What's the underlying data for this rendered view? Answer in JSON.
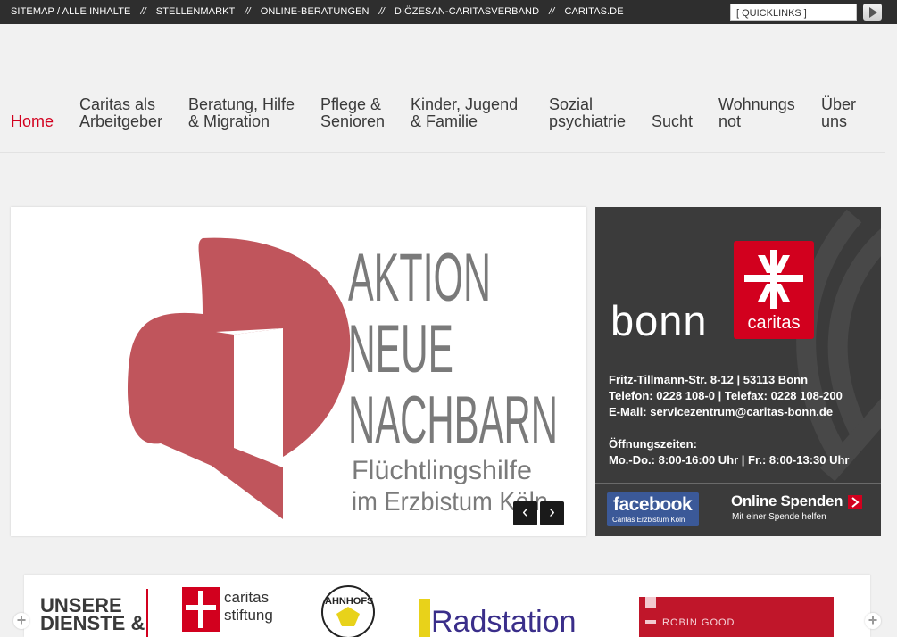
{
  "topbar": {
    "links": [
      "SITEMAP / ALLE INHALTE",
      "STELLENMARKT",
      "ONLINE-BERATUNGEN",
      "DIÖZESAN-CARITASVERBAND",
      "CARITAS.DE"
    ],
    "separator": "//",
    "quicklinks_value": "[ QUICKLINKS ]"
  },
  "nav": {
    "items": [
      {
        "label": "Home",
        "active": true
      },
      {
        "label": "Caritas als\nArbeitgeber"
      },
      {
        "label": "Beratung, Hilfe\n& Migration"
      },
      {
        "label": "Pflege &\nSenioren"
      },
      {
        "label": "Kinder, Jugend\n& Familie"
      },
      {
        "label": "Sozial\npsychiatrie"
      },
      {
        "label": "Sucht"
      },
      {
        "label": "Wohnungs\nnot"
      },
      {
        "label": "Über\nuns"
      }
    ]
  },
  "slider": {
    "headline": [
      "AKTION",
      "NEUE",
      "NACHBARN"
    ],
    "subline": [
      "Flüchtlingshilfe",
      "im Erzbistum Köln"
    ],
    "prev": "‹",
    "next": "›",
    "heart_color": "#c0555c"
  },
  "infobox": {
    "city": "bonn",
    "logo_text": "caritas",
    "address": "Fritz-Tillmann-Str. 8-12 | 53113 Bonn",
    "phone": "Telefon: 0228 108-0 | Telefax: 0228 108-200",
    "email": "E-Mail: servicezentrum@caritas-bonn.de",
    "hours_title": "Öffnungszeiten:",
    "hours": "Mo.-Do.: 8:00-16:00 Uhr | Fr.: 8:00-13:30 Uhr",
    "facebook_title": "facebook",
    "facebook_sub": "Caritas Erzbistum Köln",
    "spenden_title": "Online Spenden",
    "spenden_sub": "Mit einer Spende helfen"
  },
  "carousel": {
    "tile1": [
      "UNSERE",
      "DIENSTE &"
    ],
    "tile2": [
      "caritas",
      "stiftung"
    ],
    "tile3": "AHNHOFS",
    "tile4": "Radstation",
    "tile5": "ROBIN GOOD"
  },
  "colors": {
    "accent": "#d2001e",
    "topbar": "#2e2e2e",
    "infobox": "#3b3b3b"
  }
}
